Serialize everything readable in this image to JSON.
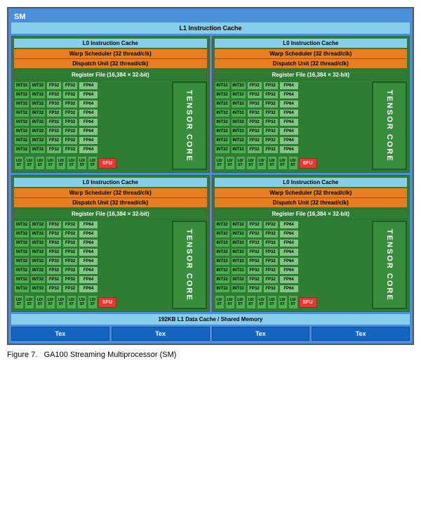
{
  "sm": {
    "title": "SM",
    "l1_cache": "L1 Instruction Cache",
    "shared_memory": "192KB L1 Data Cache / Shared Memory",
    "quadrants": [
      {
        "id": "q1",
        "l0_cache": "L0 Instruction Cache",
        "warp_scheduler": "Warp Scheduler (32 thread/clk)",
        "dispatch_unit": "Dispatch Unit (32 thread/clk)",
        "register_file": "Register File (16,384 × 32-bit)",
        "tensor_core_label": "TENSOR CORE",
        "unit_rows": [
          {
            "int32_a": "INT32",
            "int32_b": "INT32",
            "fp32_a": "FP32",
            "fp32_b": "FP32",
            "fp64": "FP64"
          },
          {
            "int32_a": "INT32",
            "int32_b": "INT32",
            "fp32_a": "FP32",
            "fp32_b": "FP32",
            "fp64": "FP64"
          },
          {
            "int32_a": "INT32",
            "int32_b": "INT32",
            "fp32_a": "FP32",
            "fp32_b": "FP32",
            "fp64": "FP64"
          },
          {
            "int32_a": "INT32",
            "int32_b": "INT32",
            "fp32_a": "FP32",
            "fp32_b": "FP32",
            "fp64": "FP64"
          },
          {
            "int32_a": "INT32",
            "int32_b": "INT32",
            "fp32_a": "FP32",
            "fp32_b": "FP32",
            "fp64": "FP64"
          },
          {
            "int32_a": "INT32",
            "int32_b": "INT32",
            "fp32_a": "FP32",
            "fp32_b": "FP32",
            "fp64": "FP64"
          },
          {
            "int32_a": "INT32",
            "int32_b": "INT32",
            "fp32_a": "FP32",
            "fp32_b": "FP32",
            "fp64": "FP64"
          },
          {
            "int32_a": "INT32",
            "int32_b": "INT32",
            "fp32_a": "FP32",
            "fp32_b": "FP32",
            "fp64": "FP64"
          }
        ],
        "ld_st_count": 8,
        "ld_st_label": "LD/ST",
        "sfu_label": "SFU"
      },
      {
        "id": "q2",
        "l0_cache": "L0 Instruction Cache",
        "warp_scheduler": "Warp Scheduler (32 thread/clk)",
        "dispatch_unit": "Dispatch Unit (32 thread/clk)",
        "register_file": "Register File (16,384 × 32-bit)",
        "tensor_core_label": "TENSOR CORE",
        "unit_rows": [
          {
            "int32_a": "INT32",
            "int32_b": "INT32",
            "fp32_a": "FP32",
            "fp32_b": "FP32",
            "fp64": "FP64"
          },
          {
            "int32_a": "INT32",
            "int32_b": "INT32",
            "fp32_a": "FP32",
            "fp32_b": "FP32",
            "fp64": "FP64"
          },
          {
            "int32_a": "INT32",
            "int32_b": "INT32",
            "fp32_a": "FP32",
            "fp32_b": "FP32",
            "fp64": "FP64"
          },
          {
            "int32_a": "INT32",
            "int32_b": "INT32",
            "fp32_a": "FP32",
            "fp32_b": "FP32",
            "fp64": "FP64"
          },
          {
            "int32_a": "INT32",
            "int32_b": "INT32",
            "fp32_a": "FP32",
            "fp32_b": "FP32",
            "fp64": "FP64"
          },
          {
            "int32_a": "INT32",
            "int32_b": "INT32",
            "fp32_a": "FP32",
            "fp32_b": "FP32",
            "fp64": "FP64"
          },
          {
            "int32_a": "INT32",
            "int32_b": "INT32",
            "fp32_a": "FP32",
            "fp32_b": "FP32",
            "fp64": "FP64"
          },
          {
            "int32_a": "INT32",
            "int32_b": "INT32",
            "fp32_a": "FP32",
            "fp32_b": "FP32",
            "fp64": "FP64"
          }
        ],
        "ld_st_count": 8,
        "ld_st_label": "LD/ST",
        "sfu_label": "SFU"
      },
      {
        "id": "q3",
        "l0_cache": "L0 Instruction Cache",
        "warp_scheduler": "Warp Scheduler (32 thread/clk)",
        "dispatch_unit": "Dispatch Unit (32 thread/clk)",
        "register_file": "Register File (16,384 × 32-bit)",
        "tensor_core_label": "TENSOR CORE",
        "unit_rows": [
          {
            "int32_a": "INT32",
            "int32_b": "INT32",
            "fp32_a": "FP32",
            "fp32_b": "FP32",
            "fp64": "FP64"
          },
          {
            "int32_a": "INT32",
            "int32_b": "INT32",
            "fp32_a": "FP32",
            "fp32_b": "FP32",
            "fp64": "FP64"
          },
          {
            "int32_a": "INT32",
            "int32_b": "INT32",
            "fp32_a": "FP32",
            "fp32_b": "FP32",
            "fp64": "FP64"
          },
          {
            "int32_a": "INT32",
            "int32_b": "INT32",
            "fp32_a": "FP32",
            "fp32_b": "FP32",
            "fp64": "FP64"
          },
          {
            "int32_a": "INT32",
            "int32_b": "INT32",
            "fp32_a": "FP32",
            "fp32_b": "FP32",
            "fp64": "FP64"
          },
          {
            "int32_a": "INT32",
            "int32_b": "INT32",
            "fp32_a": "FP32",
            "fp32_b": "FP32",
            "fp64": "FP64"
          },
          {
            "int32_a": "INT32",
            "int32_b": "INT32",
            "fp32_a": "FP32",
            "fp32_b": "FP32",
            "fp64": "FP64"
          },
          {
            "int32_a": "INT32",
            "int32_b": "INT32",
            "fp32_a": "FP32",
            "fp32_b": "FP32",
            "fp64": "FP64"
          }
        ],
        "ld_st_count": 8,
        "ld_st_label": "LD/ST",
        "sfu_label": "SFU"
      },
      {
        "id": "q4",
        "l0_cache": "L0 Instruction Cache",
        "warp_scheduler": "Warp Scheduler (32 thread/clk)",
        "dispatch_unit": "Dispatch Unit (32 thread/clk)",
        "register_file": "Register File (16,384 × 32-bit)",
        "tensor_core_label": "TENSOR CORE",
        "unit_rows": [
          {
            "int32_a": "INT32",
            "int32_b": "INT32",
            "fp32_a": "FP32",
            "fp32_b": "FP32",
            "fp64": "FP64"
          },
          {
            "int32_a": "INT32",
            "int32_b": "INT32",
            "fp32_a": "FP32",
            "fp32_b": "FP32",
            "fp64": "FP64"
          },
          {
            "int32_a": "INT32",
            "int32_b": "INT32",
            "fp32_a": "FP32",
            "fp32_b": "FP32",
            "fp64": "FP64"
          },
          {
            "int32_a": "INT32",
            "int32_b": "INT32",
            "fp32_a": "FP32",
            "fp32_b": "FP32",
            "fp64": "FP64"
          },
          {
            "int32_a": "INT32",
            "int32_b": "INT32",
            "fp32_a": "FP32",
            "fp32_b": "FP32",
            "fp64": "FP64"
          },
          {
            "int32_a": "INT32",
            "int32_b": "INT32",
            "fp32_a": "FP32",
            "fp32_b": "FP32",
            "fp64": "FP64"
          },
          {
            "int32_a": "INT32",
            "int32_b": "INT32",
            "fp32_a": "FP32",
            "fp32_b": "FP32",
            "fp64": "FP64"
          },
          {
            "int32_a": "INT32",
            "int32_b": "INT32",
            "fp32_a": "FP32",
            "fp32_b": "FP32",
            "fp64": "FP64"
          }
        ],
        "ld_st_count": 8,
        "ld_st_label": "LD/ST",
        "sfu_label": "SFU"
      }
    ],
    "tex_labels": [
      "Tex",
      "Tex",
      "Tex",
      "Tex"
    ]
  },
  "figure_caption": "Figure 7.   GA100 Streaming Multiprocessor (SM)"
}
